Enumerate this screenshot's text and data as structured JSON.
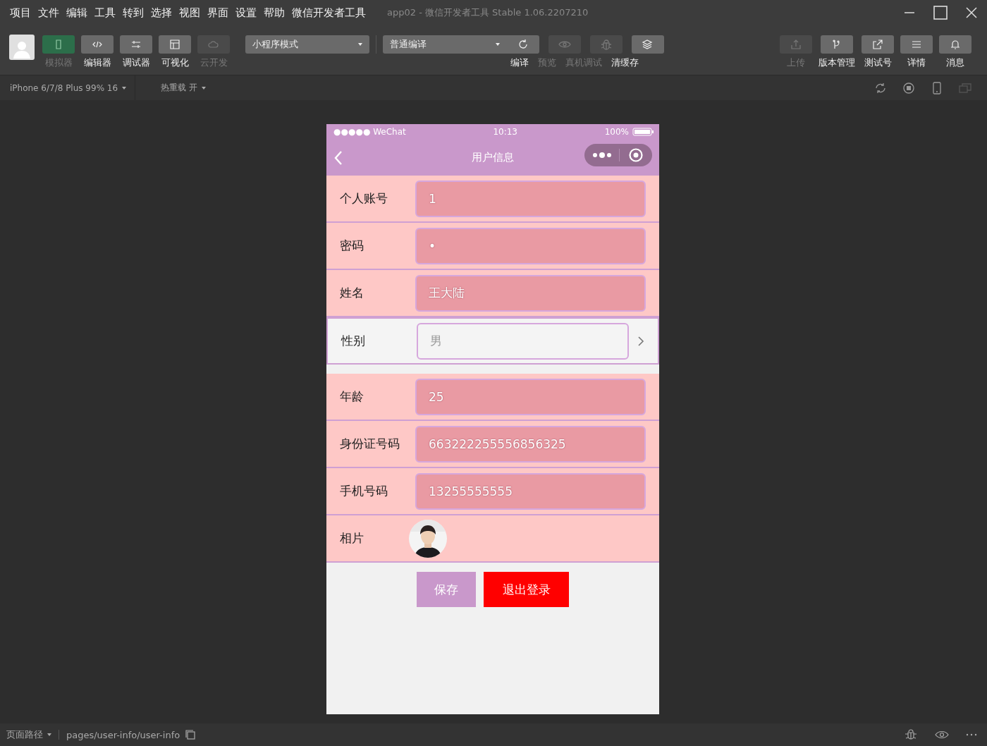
{
  "menu": [
    "项目",
    "文件",
    "编辑",
    "工具",
    "转到",
    "选择",
    "视图",
    "界面",
    "设置",
    "帮助",
    "微信开发者工具"
  ],
  "window": {
    "title": "app02 - 微信开发者工具 Stable 1.06.2207210"
  },
  "view_buttons": [
    {
      "label": "模拟器",
      "on": true,
      "disabled": false
    },
    {
      "label": "编辑器",
      "on": false,
      "disabled": false
    },
    {
      "label": "调试器",
      "on": false,
      "disabled": false
    },
    {
      "label": "可视化",
      "on": false,
      "disabled": false
    },
    {
      "label": "云开发",
      "on": false,
      "disabled": true
    }
  ],
  "mode_dropdown": "小程序模式",
  "compile_dropdown": "普通编译",
  "compile_actions": [
    {
      "label": "编译",
      "disabled": false
    },
    {
      "label": "预览",
      "disabled": true
    },
    {
      "label": "真机调试",
      "disabled": true
    },
    {
      "label": "清缓存",
      "disabled": false
    }
  ],
  "right_actions": [
    {
      "label": "上传",
      "disabled": true
    },
    {
      "label": "版本管理",
      "disabled": false
    },
    {
      "label": "测试号",
      "disabled": false
    },
    {
      "label": "详情",
      "disabled": false
    },
    {
      "label": "消息",
      "disabled": false
    }
  ],
  "sub_bar": {
    "device": "iPhone 6/7/8 Plus 99% 16",
    "hot_reload": "热重载 开"
  },
  "phone": {
    "carrier": "●●●●● WeChat",
    "time": "10:13",
    "battery": "100%",
    "nav_title": "用户信息",
    "rows": [
      {
        "kind": "input",
        "label": "个人账号",
        "value": "1"
      },
      {
        "kind": "input",
        "label": "密码",
        "value": "•"
      },
      {
        "kind": "input",
        "label": "姓名",
        "value": "王大陆"
      },
      {
        "kind": "picker",
        "label": "性别",
        "value": "男"
      },
      {
        "kind": "input",
        "label": "年龄",
        "value": "25"
      },
      {
        "kind": "input",
        "label": "身份证号码",
        "value": "663222255556856325"
      },
      {
        "kind": "input",
        "label": "手机号码",
        "value": "13255555555"
      },
      {
        "label": "相片"
      }
    ],
    "buttons": [
      {
        "kind": "primary",
        "label": "保存"
      },
      {
        "kind": "danger",
        "label": "退出登录"
      }
    ]
  },
  "status_bar": {
    "path_label": "页面路径",
    "path": "pages/user-info/user-info"
  }
}
